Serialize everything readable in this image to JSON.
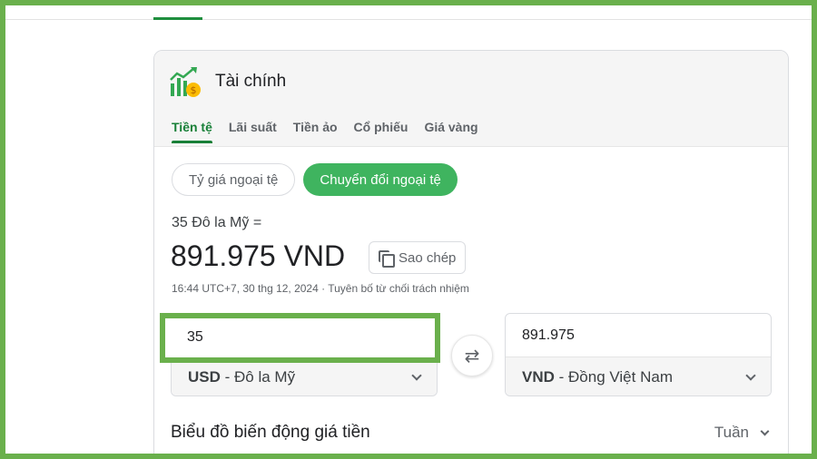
{
  "card": {
    "title": "Tài chính",
    "logo_icon": "finance-chart-icon",
    "tabs": [
      {
        "label": "Tiền tệ",
        "active": true
      },
      {
        "label": "Lãi suất",
        "active": false
      },
      {
        "label": "Tiền ảo",
        "active": false
      },
      {
        "label": "Cổ phiếu",
        "active": false
      },
      {
        "label": "Giá vàng",
        "active": false
      }
    ]
  },
  "chips": {
    "rates": "Tỷ giá ngoại tệ",
    "convert": "Chuyển đổi ngoại tệ"
  },
  "result": {
    "label": "35 Đô la Mỹ =",
    "value": "891.975 VND",
    "copy_label": "Sao chép",
    "timestamp": "16:44 UTC+7, 30 thg 12, 2024 · Tuyên bố từ chối trách nhiệm"
  },
  "converter": {
    "from_value": "35",
    "from_code": "USD",
    "from_name": " - Đô la Mỹ",
    "to_value": "891.975",
    "to_code": "VND",
    "to_name": " - Đồng Việt Nam",
    "swap_symbol": "⇄"
  },
  "chart_section": {
    "title": "Biểu đồ biến động giá tiền",
    "range": "Tuần"
  },
  "colors": {
    "accent_green": "#188038",
    "chip_green": "#3fb45f",
    "highlight_border": "#6ab04c"
  }
}
